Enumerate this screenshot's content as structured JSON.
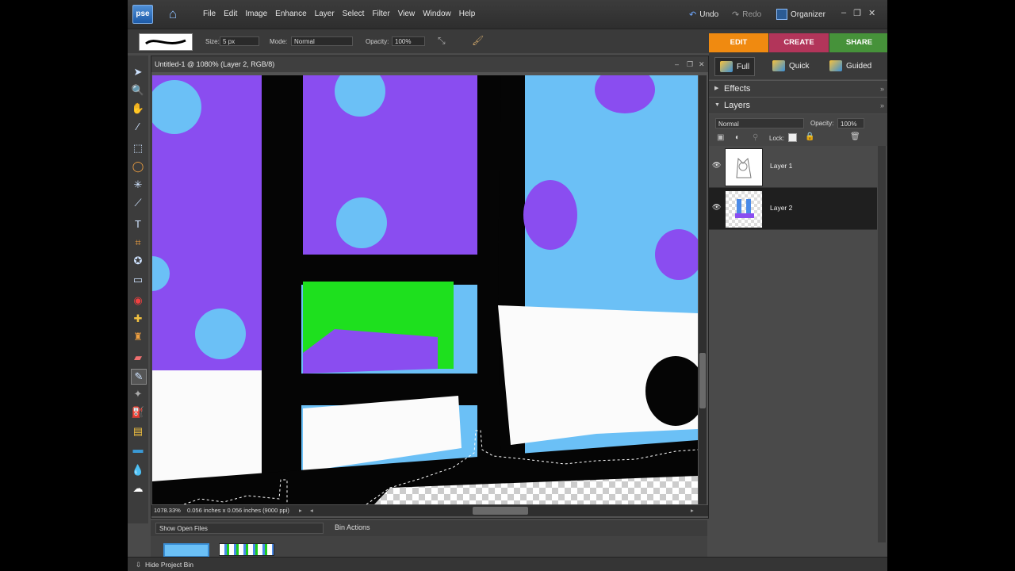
{
  "menubar": {
    "logo": "pse",
    "menus": [
      "File",
      "Edit",
      "Image",
      "Enhance",
      "Layer",
      "Select",
      "Filter",
      "View",
      "Window",
      "Help"
    ],
    "undo": "Undo",
    "redo": "Redo",
    "organizer": "Organizer"
  },
  "options": {
    "size_label": "Size:",
    "size_value": "5 px",
    "mode_label": "Mode:",
    "mode_value": "Normal",
    "opacity_label": "Opacity:",
    "opacity_value": "100%"
  },
  "tabs": {
    "edit": "EDIT",
    "create": "CREATE",
    "share": "SHARE"
  },
  "document": {
    "title": "Untitled-1 @ 1080% (Layer 2, RGB/8)",
    "zoom": "1078.33%",
    "info": "0.056 inches x 0.056 inches (9000 ppi)"
  },
  "panel": {
    "modes": [
      "Full",
      "Quick",
      "Guided"
    ],
    "effects": "Effects",
    "layers": "Layers",
    "blend_mode": "Normal",
    "opacity_label": "Opacity:",
    "opacity_value": "100%",
    "lock_label": "Lock:",
    "layer_items": [
      {
        "name": "Layer 1",
        "selected": false
      },
      {
        "name": "Layer 2",
        "selected": true
      }
    ]
  },
  "bin": {
    "show_label": "Show Open Files",
    "actions_label": "Bin Actions",
    "hide_label": "Hide Project Bin"
  },
  "colors": {
    "foreground": "#1ccc1c",
    "background": "#000000",
    "edit_tab": "#f08a10",
    "create_tab": "#b2355a",
    "share_tab": "#46923a"
  }
}
